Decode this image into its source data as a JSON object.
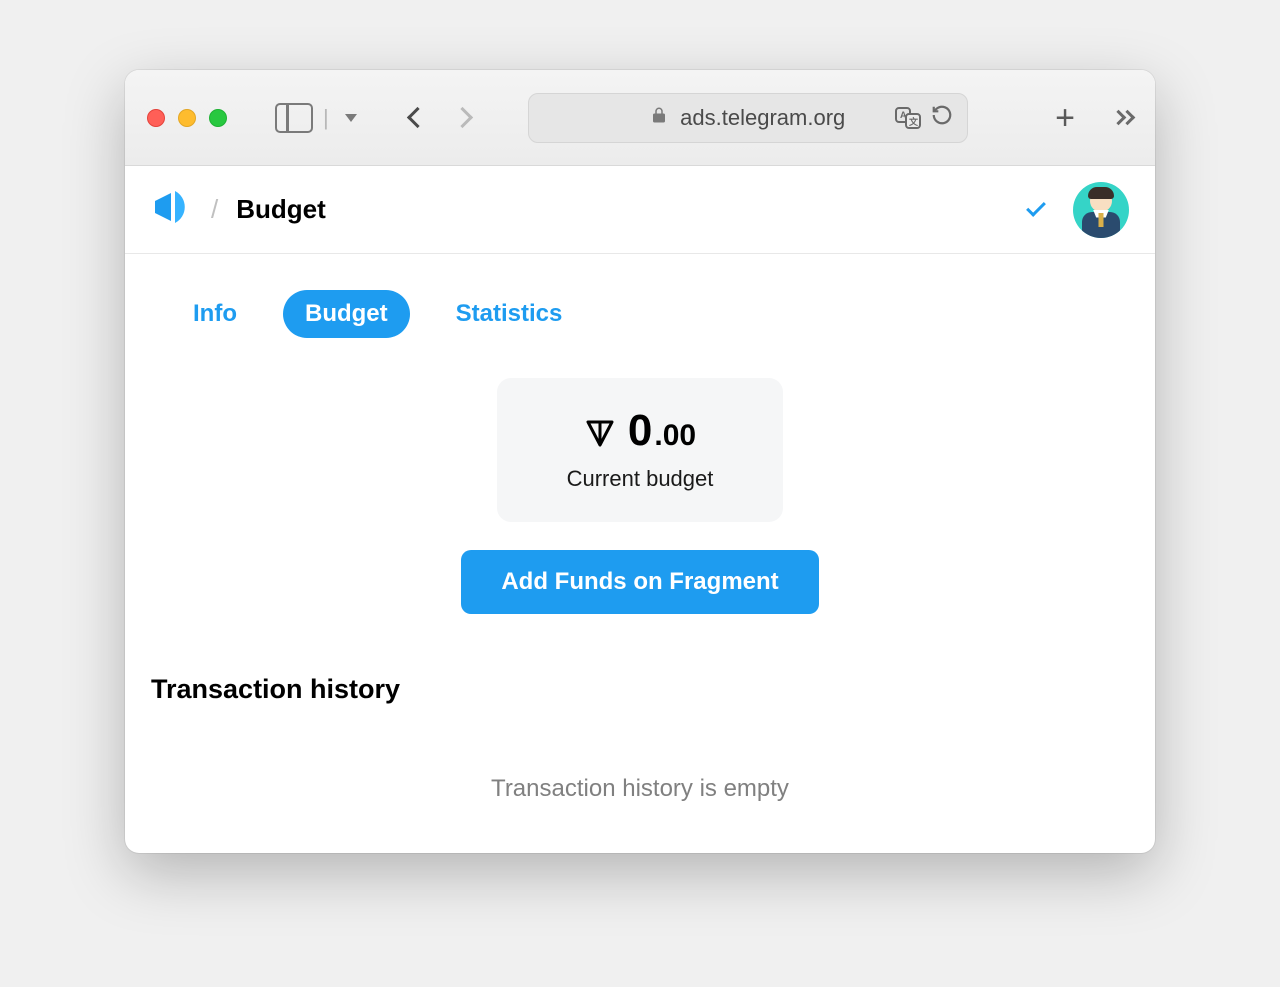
{
  "browser": {
    "url": "ads.telegram.org"
  },
  "header": {
    "breadcrumb_title": "Budget",
    "breadcrumb_sep": "/"
  },
  "tabs": [
    {
      "label": "Info",
      "active": false
    },
    {
      "label": "Budget",
      "active": true
    },
    {
      "label": "Statistics",
      "active": false
    }
  ],
  "budget": {
    "integer": "0",
    "decimal": ".00",
    "label": "Current budget",
    "add_funds_label": "Add Funds on Fragment"
  },
  "transactions": {
    "title": "Transaction history",
    "empty_message": "Transaction history is empty"
  }
}
